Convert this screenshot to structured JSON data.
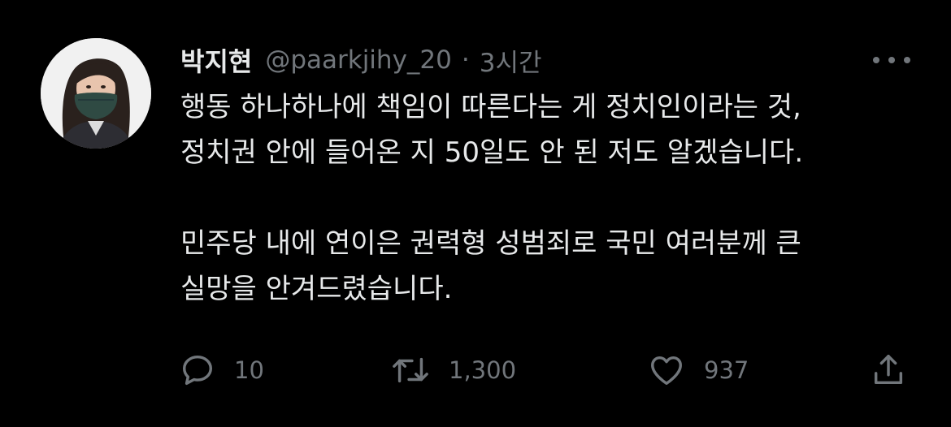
{
  "tweet": {
    "display_name": "박지현",
    "handle": "@paarkjihy_20",
    "separator": "·",
    "time": "3시간",
    "lines": [
      "행동 하나하나에 책임이 따른다는 게 정치인이라는 것,",
      "정치권 안에 들어온 지 50일도 안 된 저도 알겠습니다.",
      "민주당 내에 연이은 권력형 성범죄로 국민 여러분께 큰",
      "실망을 안겨드렸습니다."
    ],
    "stats": {
      "replies": "10",
      "retweets": "1,300",
      "likes": "937"
    }
  },
  "colors": {
    "background": "#000000",
    "primary_text": "#e7e9ea",
    "secondary_text": "#71767b"
  },
  "icons": [
    "more-icon",
    "reply-icon",
    "retweet-icon",
    "like-icon",
    "share-icon"
  ]
}
